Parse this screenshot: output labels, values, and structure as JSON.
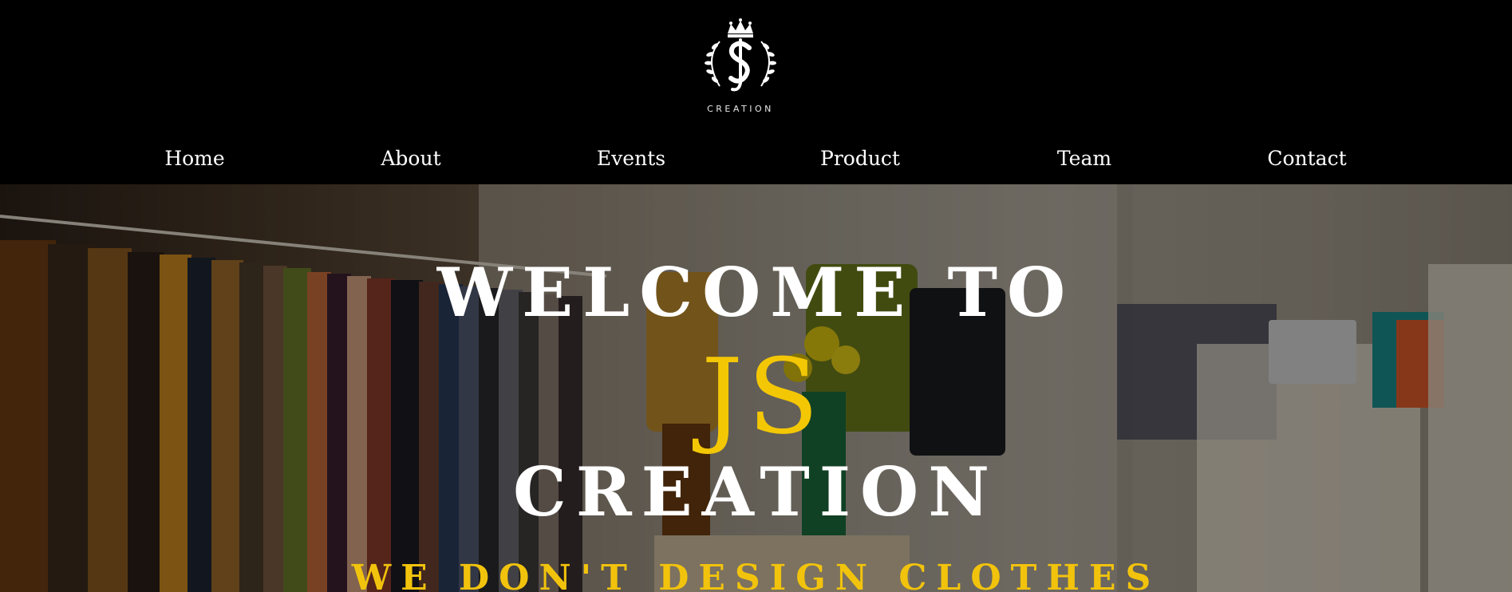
{
  "brand": {
    "logo_caption": "CREATION",
    "logo_letters": "JS"
  },
  "nav": {
    "items": [
      {
        "label": "Home"
      },
      {
        "label": "About"
      },
      {
        "label": "Events"
      },
      {
        "label": "Product"
      },
      {
        "label": "Team"
      },
      {
        "label": "Contact"
      }
    ]
  },
  "hero": {
    "line1": "WELCOME TO",
    "line2": "JS",
    "line3": "CREATION",
    "tagline": "WE DON'T DESIGN CLOTHES"
  },
  "colors": {
    "background": "#000000",
    "text": "#ffffff",
    "accent": "#f4c705"
  }
}
